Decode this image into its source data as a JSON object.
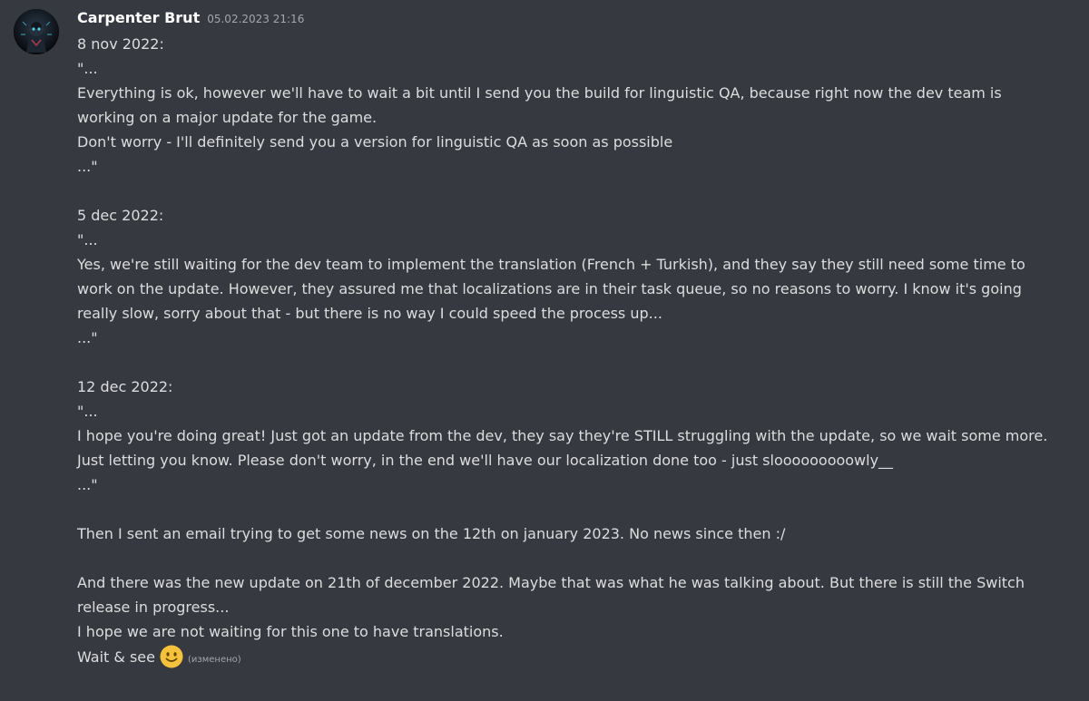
{
  "message": {
    "author": "Carpenter Brut",
    "timestamp": "05.02.2023 21:16",
    "edited_label": "(изменено)",
    "lines": [
      "8 nov 2022:",
      "\"...",
      "Everything is ok, however we'll have to wait a bit until I send you the build for linguistic QA, because right now the dev team is working on a major update for the game.",
      "Don't worry - I'll definitely send you a version for linguistic QA as soon as possible",
      "...\"",
      "",
      "5 dec 2022:",
      "\"...",
      "Yes, we're still waiting for the dev team to implement the translation (French + Turkish), and they say they still need some time to work on the update. However, they assured me that localizations are in their task queue, so no reasons to worry. I know it's going really slow, sorry about that - but there is no way I could speed the process up...",
      "...\"",
      "",
      "12 dec 2022:",
      "\"...",
      "I hope you're doing great! Just got an update from the dev, they say they're STILL struggling with the update, so we wait some more.",
      "Just letting you know. Please don't worry, in the end we'll have our localization done too - just slooooooooowly__",
      "...\"",
      "",
      "Then I sent an email trying to get some news on the 12th on january 2023. No news since then :/",
      "",
      "And there was the new update on 21th of december 2022. Maybe that was what he was talking about. But there is still the Switch release in progress...",
      "I hope we are not waiting for this one to have translations.",
      "Wait & see"
    ],
    "emoji": "slightly-smiling-face",
    "colors": {
      "background": "#36393f",
      "username": "#ffffff",
      "text": "#dcddde",
      "muted": "#a3a6aa",
      "emoji": "#f5c33b"
    }
  }
}
